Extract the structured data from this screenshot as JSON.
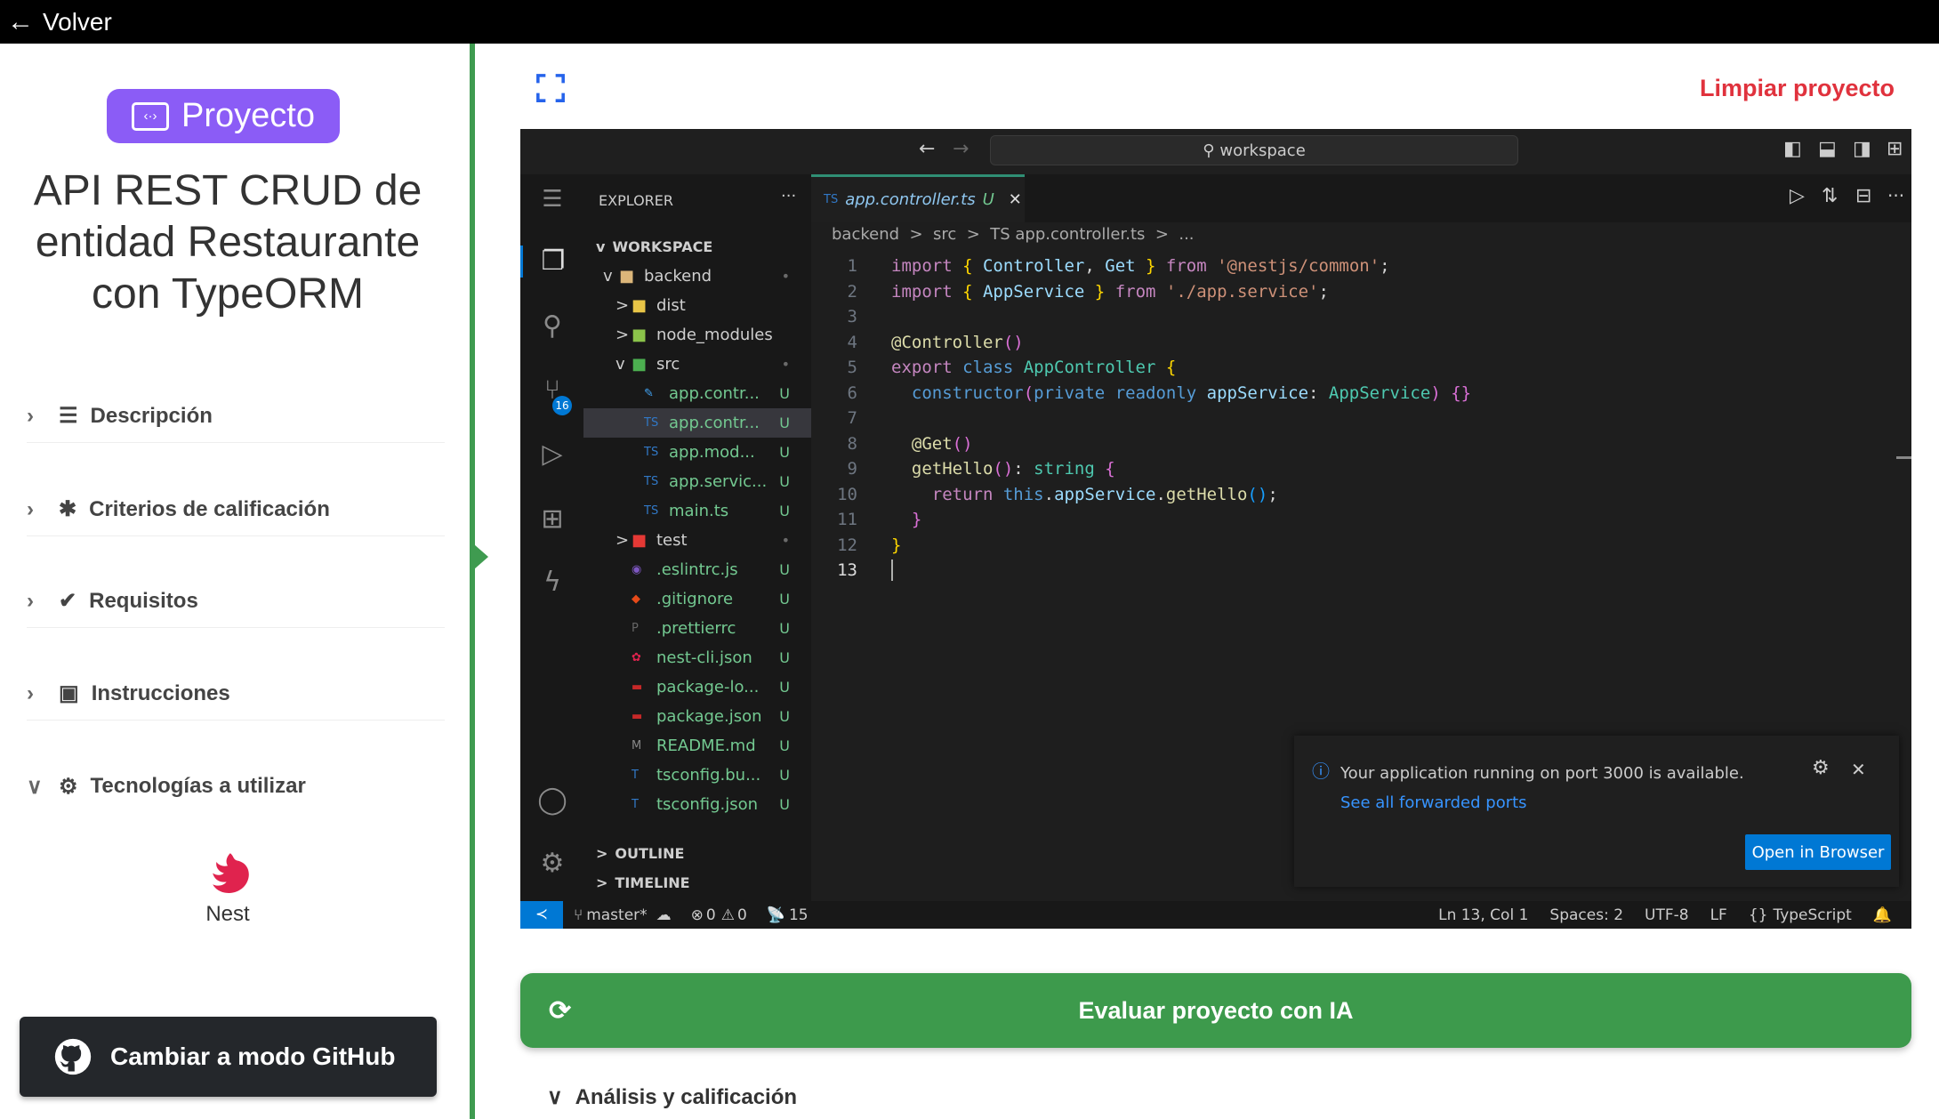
{
  "topbar": {
    "back_label": "Volver"
  },
  "sidebar": {
    "badge": "Proyecto",
    "title": "API REST CRUD de entidad Restaurante con TypeORM",
    "sections": [
      {
        "label": "Descripción",
        "icon": "list-icon",
        "open": false
      },
      {
        "label": "Criterios de calificación",
        "icon": "asterisk-icon",
        "open": false
      },
      {
        "label": "Requisitos",
        "icon": "check-double-icon",
        "open": false
      },
      {
        "label": "Instrucciones",
        "icon": "image-icon",
        "open": false
      },
      {
        "label": "Tecnologías a utilizar",
        "icon": "gear-icon",
        "open": true
      }
    ],
    "tech": "Nest",
    "github_button": "Cambiar a modo GitHub"
  },
  "main": {
    "clean_label": "Limpiar proyecto",
    "evaluate_label": "Evaluar proyecto con IA",
    "analysis_label": "Análisis y calificación"
  },
  "vscode": {
    "search": "workspace",
    "explorer_title": "EXPLORER",
    "workspace": "WORKSPACE",
    "scm_badge": "16",
    "tree": [
      {
        "name": "backend",
        "depth": 0,
        "chev": "v",
        "color": "#dcb67a",
        "status": "•"
      },
      {
        "name": "dist",
        "depth": 1,
        "chev": ">",
        "color": "#e8c547",
        "status": ""
      },
      {
        "name": "node_modules",
        "depth": 1,
        "chev": ">",
        "color": "#8bc34a",
        "status": ""
      },
      {
        "name": "src",
        "depth": 1,
        "chev": "v",
        "color": "#4caf50",
        "status": "•"
      },
      {
        "name": "app.contr...",
        "depth": 2,
        "chev": "",
        "color": "#42a5f5",
        "status": "U",
        "ic": "✎"
      },
      {
        "name": "app.contr...",
        "depth": 2,
        "chev": "",
        "color": "#3178c6",
        "status": "U",
        "ic": "TS",
        "sel": true
      },
      {
        "name": "app.mod...",
        "depth": 2,
        "chev": "",
        "color": "#3178c6",
        "status": "U",
        "ic": "TS"
      },
      {
        "name": "app.servic...",
        "depth": 2,
        "chev": "",
        "color": "#3178c6",
        "status": "U",
        "ic": "TS"
      },
      {
        "name": "main.ts",
        "depth": 2,
        "chev": "",
        "color": "#3178c6",
        "status": "U",
        "ic": "TS"
      },
      {
        "name": "test",
        "depth": 1,
        "chev": ">",
        "color": "#e53935",
        "status": "•"
      },
      {
        "name": ".eslintrc.js",
        "depth": 1,
        "chev": "",
        "color": "#7e57c2",
        "status": "U",
        "ic": "◉"
      },
      {
        "name": ".gitignore",
        "depth": 1,
        "chev": "",
        "color": "#e64a19",
        "status": "U",
        "ic": "◆"
      },
      {
        "name": ".prettierrc",
        "depth": 1,
        "chev": "",
        "color": "#666",
        "status": "U",
        "ic": "P"
      },
      {
        "name": "nest-cli.json",
        "depth": 1,
        "chev": "",
        "color": "#e0234e",
        "status": "U",
        "ic": "✿"
      },
      {
        "name": "package-lo...",
        "depth": 1,
        "chev": "",
        "color": "#c62828",
        "status": "U",
        "ic": "▬"
      },
      {
        "name": "package.json",
        "depth": 1,
        "chev": "",
        "color": "#c62828",
        "status": "U",
        "ic": "▬"
      },
      {
        "name": "README.md",
        "depth": 1,
        "chev": "",
        "color": "#888",
        "status": "U",
        "ic": "M"
      },
      {
        "name": "tsconfig.bu...",
        "depth": 1,
        "chev": "",
        "color": "#3178c6",
        "status": "U",
        "ic": "T"
      },
      {
        "name": "tsconfig.json",
        "depth": 1,
        "chev": "",
        "color": "#3178c6",
        "status": "U",
        "ic": "T"
      }
    ],
    "outline": "OUTLINE",
    "timeline": "TIMELINE",
    "tab": {
      "name": "app.controller.ts",
      "status": "U"
    },
    "breadcrumb": "backend  >  src  >  TS app.controller.ts  >  ...",
    "code": [
      [
        [
          "import ",
          "kw"
        ],
        [
          "{ ",
          "br1"
        ],
        [
          "Controller",
          "var"
        ],
        [
          ", ",
          "pn"
        ],
        [
          "Get",
          "var"
        ],
        [
          " }",
          "br1"
        ],
        [
          " from ",
          "kw"
        ],
        [
          "'@nestjs/common'",
          "str"
        ],
        [
          ";",
          "pn"
        ]
      ],
      [
        [
          "import ",
          "kw"
        ],
        [
          "{ ",
          "br1"
        ],
        [
          "AppService",
          "var"
        ],
        [
          " }",
          "br1"
        ],
        [
          " from ",
          "kw"
        ],
        [
          "'./app.service'",
          "str"
        ],
        [
          ";",
          "pn"
        ]
      ],
      [],
      [
        [
          "@Controller",
          "fn"
        ],
        [
          "()",
          "br2"
        ]
      ],
      [
        [
          "export ",
          "kw"
        ],
        [
          "class ",
          "kb"
        ],
        [
          "AppController ",
          "cls"
        ],
        [
          "{",
          "br1"
        ]
      ],
      [
        [
          "  constructor",
          "kb"
        ],
        [
          "(",
          "br2"
        ],
        [
          "private ",
          "kb"
        ],
        [
          "readonly ",
          "kb"
        ],
        [
          "appService",
          "var"
        ],
        [
          ": ",
          "pn"
        ],
        [
          "AppService",
          "cls"
        ],
        [
          ") ",
          "br2"
        ],
        [
          "{}",
          "br2"
        ]
      ],
      [],
      [
        [
          "  @Get",
          "fn"
        ],
        [
          "()",
          "br2"
        ]
      ],
      [
        [
          "  getHello",
          "fn"
        ],
        [
          "()",
          "br2"
        ],
        [
          ": ",
          "pn"
        ],
        [
          "string ",
          "cls"
        ],
        [
          "{",
          "br2"
        ]
      ],
      [
        [
          "    return ",
          "kw"
        ],
        [
          "this",
          "kb"
        ],
        [
          ".",
          "pn"
        ],
        [
          "appService",
          "var"
        ],
        [
          ".",
          "pn"
        ],
        [
          "getHello",
          "fn"
        ],
        [
          "()",
          "br3"
        ],
        [
          ";",
          "pn"
        ]
      ],
      [
        [
          "  }",
          "br2"
        ]
      ],
      [
        [
          "}",
          "br1"
        ]
      ],
      []
    ],
    "current_line": 13,
    "notification": {
      "text": "Your application running on port 3000 is available.",
      "link": "See all forwarded ports",
      "button": "Open in Browser"
    },
    "status": {
      "branch": "master*",
      "errors": "0",
      "warnings": "0",
      "ports": "15",
      "position": "Ln 13, Col 1",
      "spaces": "Spaces: 2",
      "encoding": "UTF-8",
      "eol": "LF",
      "language": "TypeScript"
    }
  }
}
